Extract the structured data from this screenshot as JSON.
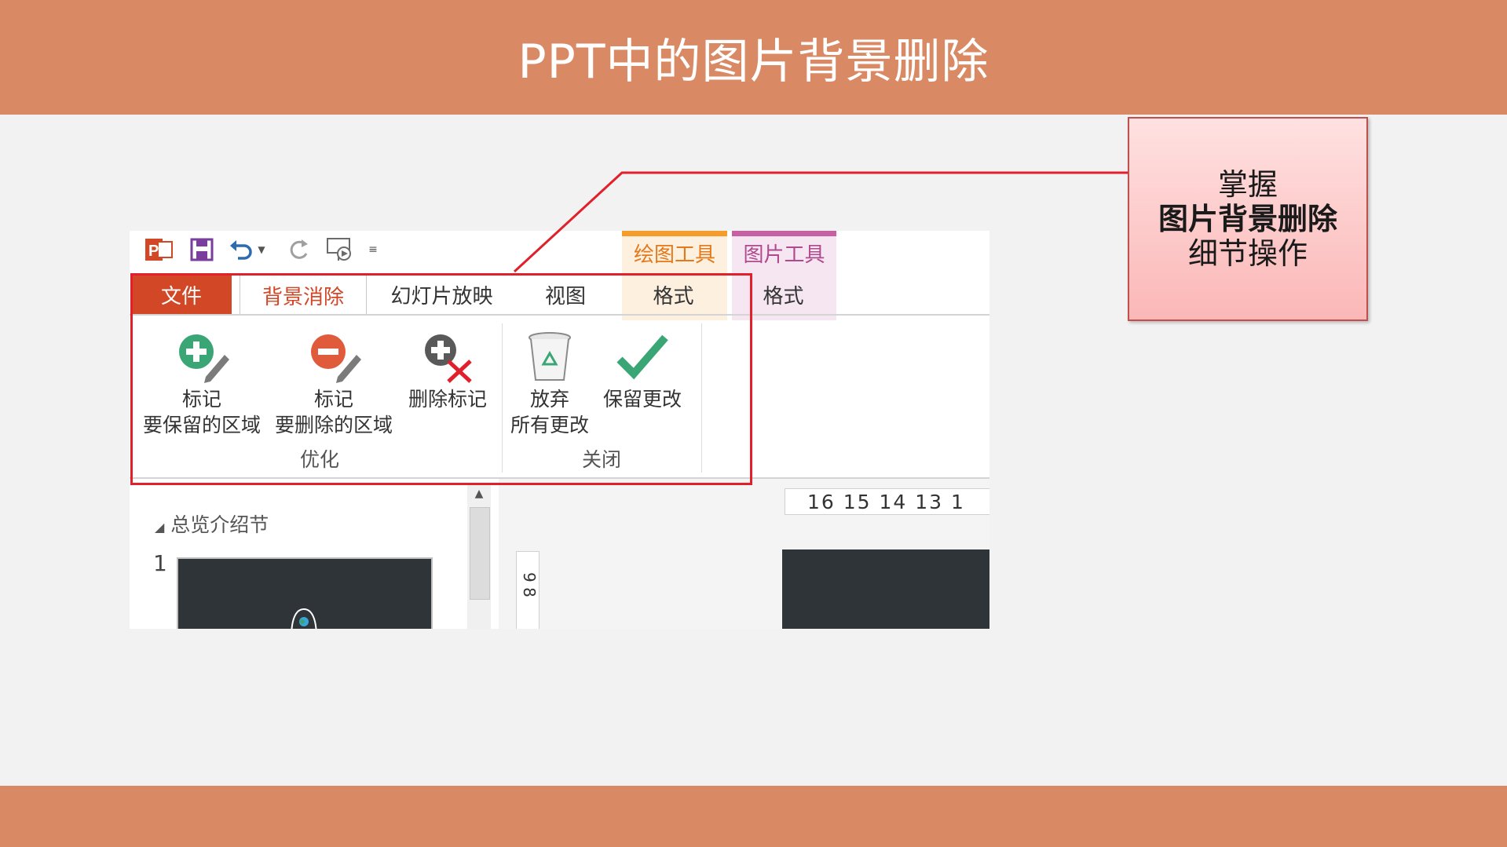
{
  "slide": {
    "title": "PPT中的图片背景删除",
    "note": {
      "line1": "掌握",
      "line2": "图片背景删除",
      "line3": "细节操作"
    }
  },
  "colors": {
    "band": "#d98963",
    "file_tab": "#d24726",
    "highlight": "#e0202a",
    "drawing_tools": "#f59d2a",
    "picture_tools": "#c75fa3"
  },
  "qat": {
    "icons": [
      "powerpoint-logo-icon",
      "save-icon",
      "undo-icon",
      "dropdown-icon",
      "redo-icon",
      "presentation-icon",
      "customize-icon"
    ]
  },
  "context_tabs": {
    "drawing_tools": "绘图工具",
    "picture_tools": "图片工具"
  },
  "tabs": {
    "file": "文件",
    "bg_removal": "背景消除",
    "slideshow": "幻灯片放映",
    "view": "视图",
    "format1": "格式",
    "format2": "格式"
  },
  "ribbon": {
    "mark_keep": "标记\n要保留的区域",
    "mark_remove": "标记\n要删除的区域",
    "delete_mark": "删除标记",
    "discard": "放弃\n所有更改",
    "keep": "保留更改",
    "group_refine": "优化",
    "group_close": "关闭"
  },
  "panel": {
    "section": "总览介绍节",
    "slide_number": "1",
    "ruler_ticks": "16 15 14 13 1",
    "v_ruler_ticks": "9 8"
  }
}
